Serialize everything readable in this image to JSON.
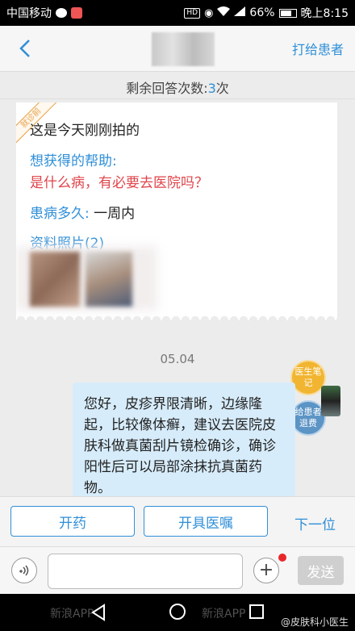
{
  "status_bar": {
    "carrier": "中国移动",
    "battery": "66%",
    "time": "晚上8:15",
    "hd_label": "HD"
  },
  "header": {
    "call_patient_label": "打给患者"
  },
  "remaining": {
    "prefix": "剩余回答次数:",
    "count": "3",
    "suffix": "次"
  },
  "consult_card": {
    "ribbon": "就诊前",
    "description": "这是今天刚刚拍的",
    "help_label": "想获得的帮助:",
    "help_text": "是什么病，有必要去医院吗？",
    "duration_label": "患病多久:",
    "duration_value": "一周内",
    "photos_label": "资料照片(2)"
  },
  "chat": {
    "date": "05.04",
    "message": "您好，皮疹界限清晰，边缘隆起，比较像体癣，建议去医院皮肤科做真菌刮片镜检确诊，确诊阳性后可以局部涂抹抗真菌药物。"
  },
  "side_badges": {
    "note": "医生笔记",
    "refund": "给患者退费"
  },
  "actions": {
    "prescribe": "开药",
    "advice": "开具医嘱",
    "next": "下一位"
  },
  "input_bar": {
    "send": "发送"
  },
  "footer": {
    "watermark": "新浪APP",
    "credit": "@皮肤科小医生"
  },
  "colors": {
    "accent": "#2f8fd8",
    "alert_red": "#e0444a",
    "bubble": "#d7ecfa"
  }
}
